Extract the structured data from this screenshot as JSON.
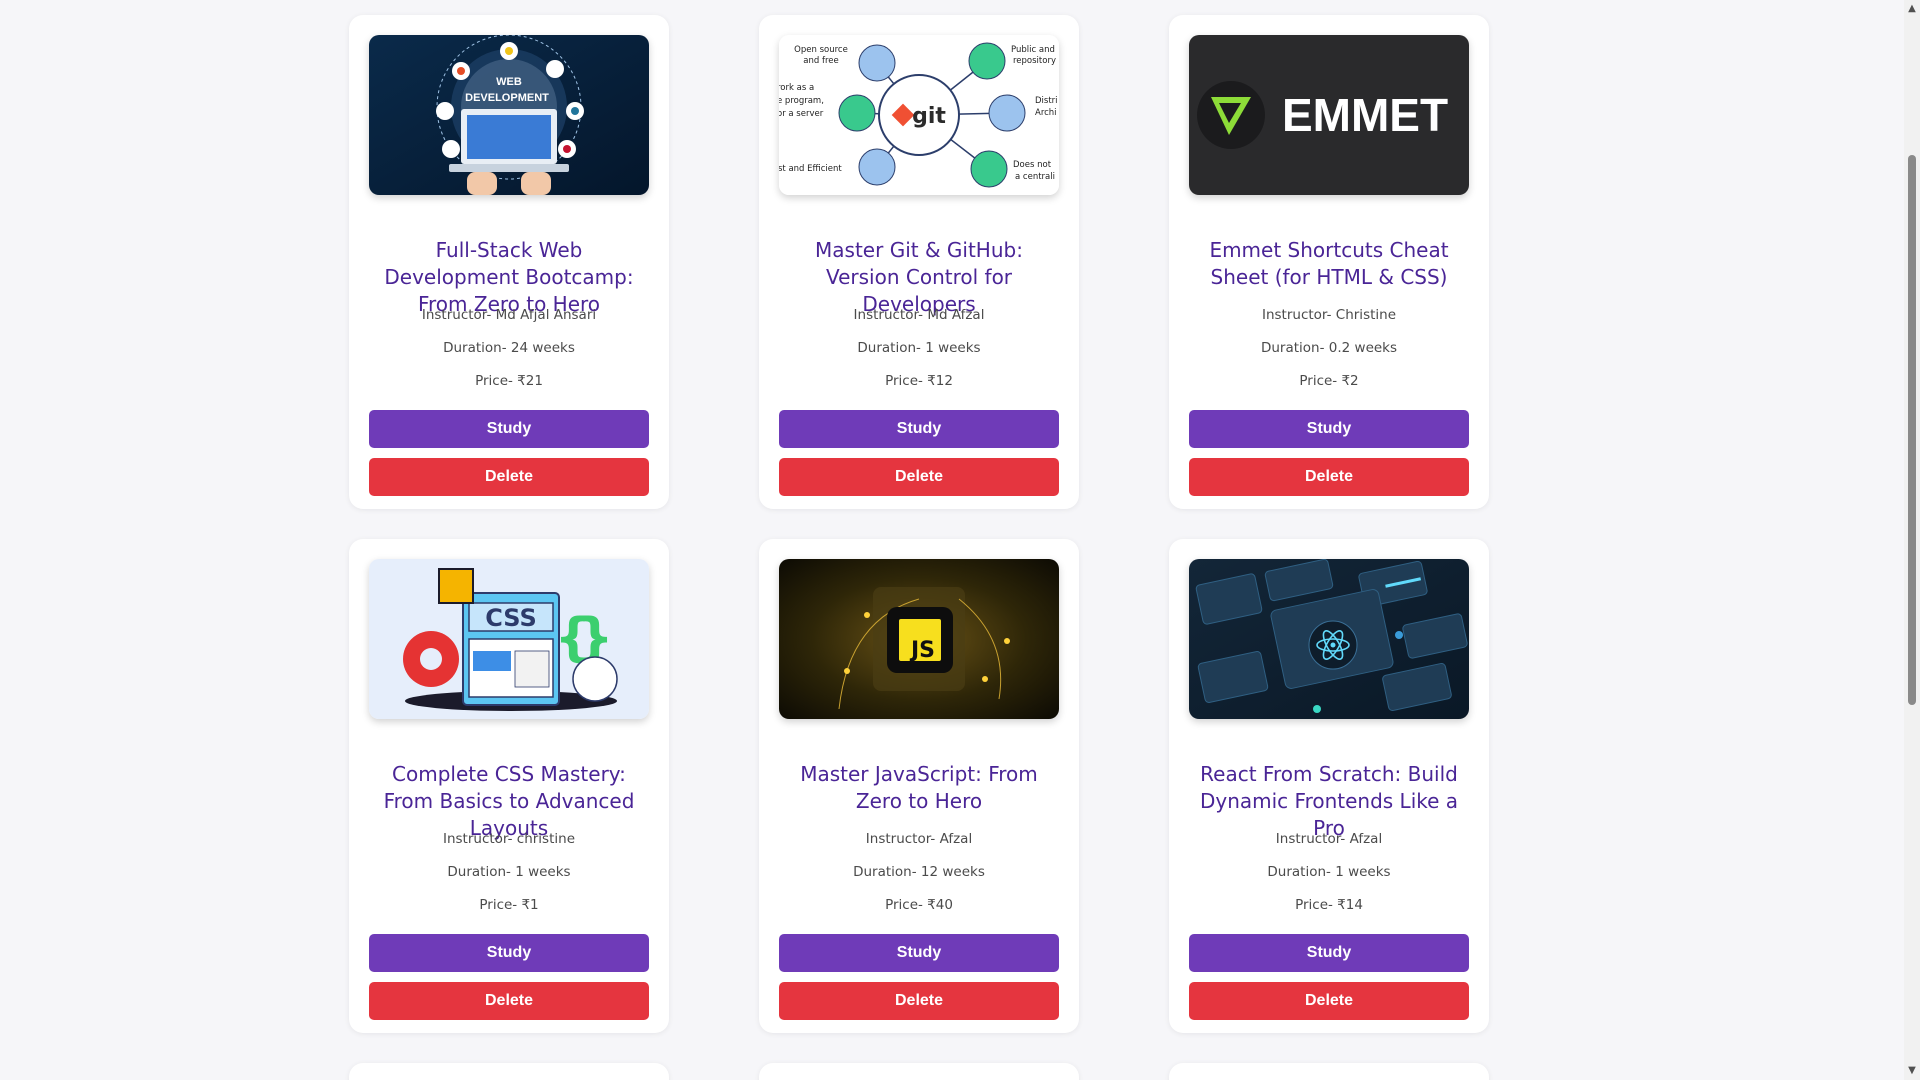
{
  "courses": [
    {
      "title": "Full-Stack Web Development Bootcamp: From Zero to Hero",
      "instructor": "Instructor- Md Afjal Ansari",
      "duration": "Duration- 24 weeks",
      "price": "Price- ₹21",
      "image": "web-development-illustration",
      "image_text": [
        "WEB",
        "DEVELOPMENT"
      ]
    },
    {
      "title": "Master Git & GitHub: Version Control for Developers",
      "instructor": "Instructor- Md Afzal",
      "duration": "Duration- 1 weeks",
      "price": "Price- ₹12",
      "image": "git-diagram-illustration",
      "image_text": [
        "git",
        "Open source",
        "and free",
        "Public and",
        "repository",
        "rork as a",
        "e program,",
        "or a server",
        "Distri",
        "Archi",
        "st and Efficient",
        "Does not",
        "a centrali"
      ]
    },
    {
      "title": "Emmet Shortcuts Cheat Sheet (for HTML & CSS)",
      "instructor": "Instructor- Christine",
      "duration": "Duration- 0.2 weeks",
      "price": "Price- ₹2",
      "image": "emmet-logo",
      "image_text": [
        "EMMET"
      ]
    },
    {
      "title": "Complete CSS Mastery: From Basics to Advanced Layouts",
      "instructor": "Instructor- christine",
      "duration": "Duration- 1 weeks",
      "price": "Price- ₹1",
      "image": "css-illustration",
      "image_text": [
        "CSS"
      ]
    },
    {
      "title": "Master JavaScript: From Zero to Hero",
      "instructor": "Instructor- Afzal",
      "duration": "Duration- 12 weeks",
      "price": "Price- ₹40",
      "image": "javascript-logo",
      "image_text": [
        "JS"
      ]
    },
    {
      "title": "React From Scratch: Build Dynamic Frontends Like a Pro",
      "instructor": "Instructor- Afzal",
      "duration": "Duration- 1 weeks",
      "price": "Price- ₹14",
      "image": "react-illustration",
      "image_text": []
    }
  ],
  "buttons": {
    "study": "Study",
    "delete": "Delete"
  },
  "scrollbar": {
    "up": "▲",
    "down": "▼"
  },
  "colors": {
    "title": "#4a2596",
    "study": "#6f3bb8",
    "delete": "#e5353f",
    "background": "#f6f6f9"
  }
}
